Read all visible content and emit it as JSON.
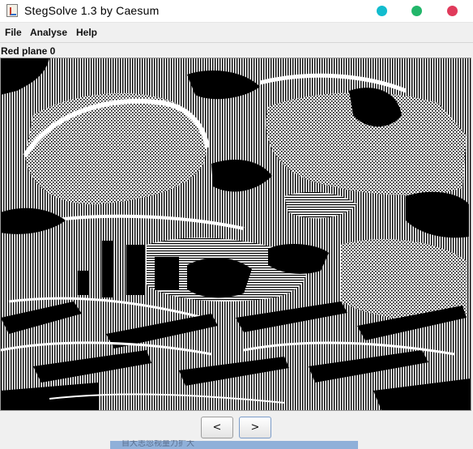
{
  "window": {
    "title": "StegSolve 1.3 by Caesum",
    "buttons": [
      {
        "name": "minimize",
        "color": "#12bcce"
      },
      {
        "name": "maximize",
        "color": "#22b66a"
      },
      {
        "name": "close",
        "color": "#e03a5b"
      }
    ]
  },
  "menu": {
    "items": [
      "File",
      "Analyse",
      "Help"
    ]
  },
  "plane_label": "Red plane 0",
  "image": {
    "description_icon": "bit-plane-image",
    "foreground": "#000000",
    "background": "#ffffff"
  },
  "navigation": {
    "prev_label": "<",
    "next_label": ">"
  },
  "taskbar": {
    "text": "自大志忽视量力扩大"
  }
}
